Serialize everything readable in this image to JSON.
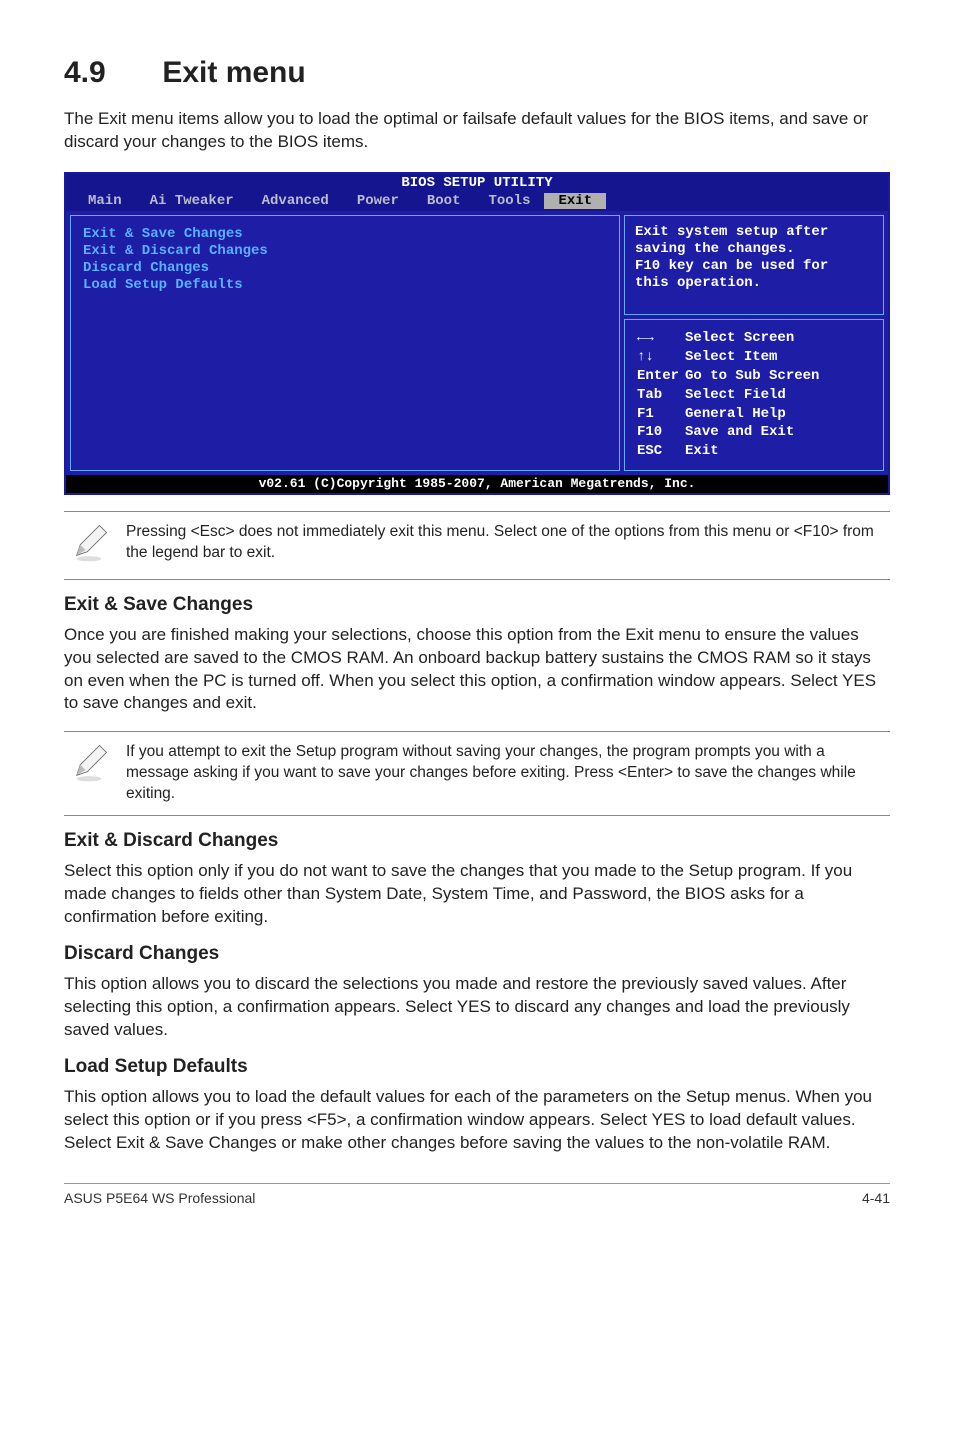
{
  "section": {
    "number": "4.9",
    "title": "Exit menu"
  },
  "intro": "The Exit menu items allow you to load the optimal or failsafe default values for the BIOS items, and save or discard your changes to the BIOS items.",
  "bios": {
    "title": "BIOS SETUP UTILITY",
    "tabs": [
      "Main",
      "Ai Tweaker",
      "Advanced",
      "Power",
      "Boot",
      "Tools",
      "Exit"
    ],
    "selected_tab": "Exit",
    "menu_items": [
      "Exit & Save Changes",
      "Exit & Discard Changes",
      "Discard Changes",
      "",
      "Load Setup Defaults"
    ],
    "help_lines": [
      "Exit system setup after",
      "saving the changes.",
      "",
      "F10 key can be used for",
      "this operation."
    ],
    "keys": [
      {
        "k": "←→",
        "v": "Select Screen"
      },
      {
        "k": "↑↓",
        "v": "Select Item"
      },
      {
        "k": "Enter",
        "v": "Go to Sub Screen"
      },
      {
        "k": "Tab",
        "v": "Select Field"
      },
      {
        "k": "F1",
        "v": "General Help"
      },
      {
        "k": "F10",
        "v": "Save and Exit"
      },
      {
        "k": "ESC",
        "v": "Exit"
      }
    ],
    "footer": "v02.61 (C)Copyright 1985-2007, American Megatrends, Inc."
  },
  "note1": "Pressing <Esc> does not immediately exit this menu. Select one of the options from this menu or <F10> from the legend bar to exit.",
  "sections": {
    "s1": {
      "heading": "Exit & Save Changes",
      "body": "Once you are finished making your selections, choose this option from the Exit menu to ensure the values you selected are saved to the CMOS RAM. An onboard backup battery sustains the CMOS RAM so it stays on even when the PC is turned off. When you select this option, a confirmation window appears. Select YES to save changes and exit."
    },
    "note2": " If you attempt to exit the Setup program without saving your changes, the program prompts you with a message asking if you want to save your changes before exiting. Press <Enter>  to save the  changes while exiting.",
    "s2": {
      "heading": "Exit & Discard Changes",
      "body": "Select this option only if you do not want to save the changes that you  made to the Setup program. If you made changes to fields other than System Date, System Time, and Password, the BIOS asks for a confirmation before exiting."
    },
    "s3": {
      "heading": "Discard Changes",
      "body": "This option allows you to discard the selections you made and restore the previously saved values. After selecting this option, a confirmation appears. Select YES to discard any changes and load the previously saved values."
    },
    "s4": {
      "heading": "Load Setup Defaults",
      "body": "This option allows you to load the default values for each of the parameters on the Setup menus. When you select this option or if you press <F5>, a confirmation window appears. Select YES to load default values. Select Exit & Save Changes or make other changes before saving the values to the non-volatile RAM."
    }
  },
  "footer": {
    "left": "ASUS P5E64 WS Professional",
    "right": "4-41"
  }
}
